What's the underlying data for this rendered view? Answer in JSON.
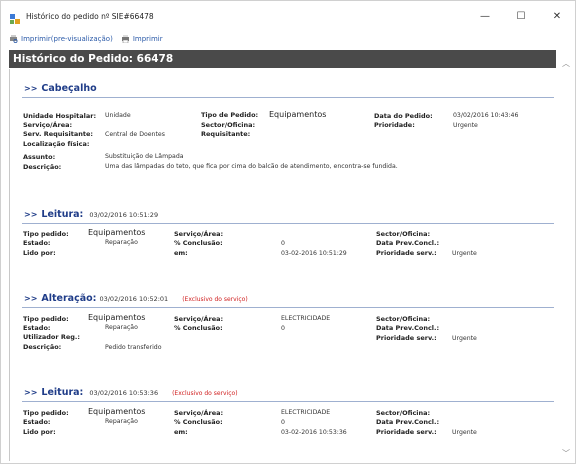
{
  "window": {
    "title": "Histórico do pedido nº SIE#66478",
    "controls": {
      "minimize": "—",
      "maximize": "☐",
      "close": "✕"
    }
  },
  "toolbar": {
    "preview_label": "Imprimir(pre-visualização)",
    "print_label": "Imprimir"
  },
  "doc": {
    "heading": "Histórico do Pedido: 66478"
  },
  "cabecalho": {
    "arrow": ">>",
    "title": "Cabeçalho",
    "unidade_label": "Unidade Hospitalar:",
    "unidade_value": "Unidade",
    "tipo_label": "Tipo de Pedido:",
    "tipo_value": "Equipamentos",
    "data_label": "Data do Pedido:",
    "data_value": "03/02/2016 10:43:46",
    "servico_label": "Serviço/Área:",
    "sector_label": "Sector/Oficina:",
    "prioridade_label": "Prioridade:",
    "prioridade_value": "Urgente",
    "requisitante_label": "Serv. Requisitante:",
    "requisitante_value": "Central de Doentes",
    "requisitante2_label": "Requisitante:",
    "localizacao_label": "Localização física:",
    "assunto_label": "Assunto:",
    "assunto_value": "Substituição de Lâmpada",
    "descricao_label": "Descrição:",
    "descricao_value": "Uma das lâmpadas do teto, que fica por cima do balcão de atendimento, encontra-se fundida."
  },
  "leitura1": {
    "arrow": ">>",
    "title": "Leitura:",
    "timestamp": "03/02/2016 10:51:29",
    "tipo_label": "Tipo pedido:",
    "tipo_value": "Equipamentos",
    "servico_label": "Serviço/Área:",
    "sector_label": "Sector/Oficina:",
    "estado_label": "Estado:",
    "estado_value": "Reparação",
    "conclusao_label": "% Conclusão:",
    "conclusao_value": "0",
    "dataprev_label": "Data Prev.Concl.:",
    "lido_label": "Lido por:",
    "em_label": "em:",
    "em_value": "03-02-2016 10:51:29",
    "prioridade_label": "Prioridade serv.:",
    "prioridade_value": "Urgente"
  },
  "alteracao": {
    "arrow": ">>",
    "title": "Alteração:",
    "timestamp": "03/02/2016 10:52:01",
    "exclusivo": "(Exclusivo do serviço)",
    "tipo_label": "Tipo pedido:",
    "tipo_value": "Equipamentos",
    "servico_label": "Serviço/Área:",
    "servico_value": "ELECTRICIDADE",
    "sector_label": "Sector/Oficina:",
    "estado_label": "Estado:",
    "estado_value": "Reparação",
    "conclusao_label": "% Conclusão:",
    "conclusao_value": "0",
    "dataprev_label": "Data Prev.Concl.:",
    "utilizador_label": "Utilizador Reg.:",
    "prioridade_label": "Prioridade serv.:",
    "prioridade_value": "Urgente",
    "descricao_label": "Descrição:",
    "descricao_value": "Pedido transferido"
  },
  "leitura2": {
    "arrow": ">>",
    "title": "Leitura:",
    "timestamp": "03/02/2016 10:53:36",
    "exclusivo": "(Exclusivo do serviço)",
    "tipo_label": "Tipo pedido:",
    "tipo_value": "Equipamentos",
    "servico_label": "Serviço/Área:",
    "servico_value": "ELECTRICIDADE",
    "sector_label": "Sector/Oficina:",
    "estado_label": "Estado:",
    "estado_value": "Reparação",
    "conclusao_label": "% Conclusão:",
    "conclusao_value": "0",
    "dataprev_label": "Data Prev.Concl.:",
    "lido_label": "Lido por:",
    "em_label": "em:",
    "em_value": "03-02-2016 10:53:36",
    "prioridade_label": "Prioridade serv.:",
    "prioridade_value": "Urgente"
  },
  "icons": {
    "app": "app-icon",
    "preview": "print-preview-icon",
    "print": "printer-icon",
    "scroll_up": "scroll-up-icon",
    "scroll_down": "scroll-down-icon"
  },
  "colors": {
    "header_bg": "#4a4a4a",
    "section_title": "#1f3c88",
    "exclusive": "#d02020",
    "link": "#2b5aa8"
  }
}
